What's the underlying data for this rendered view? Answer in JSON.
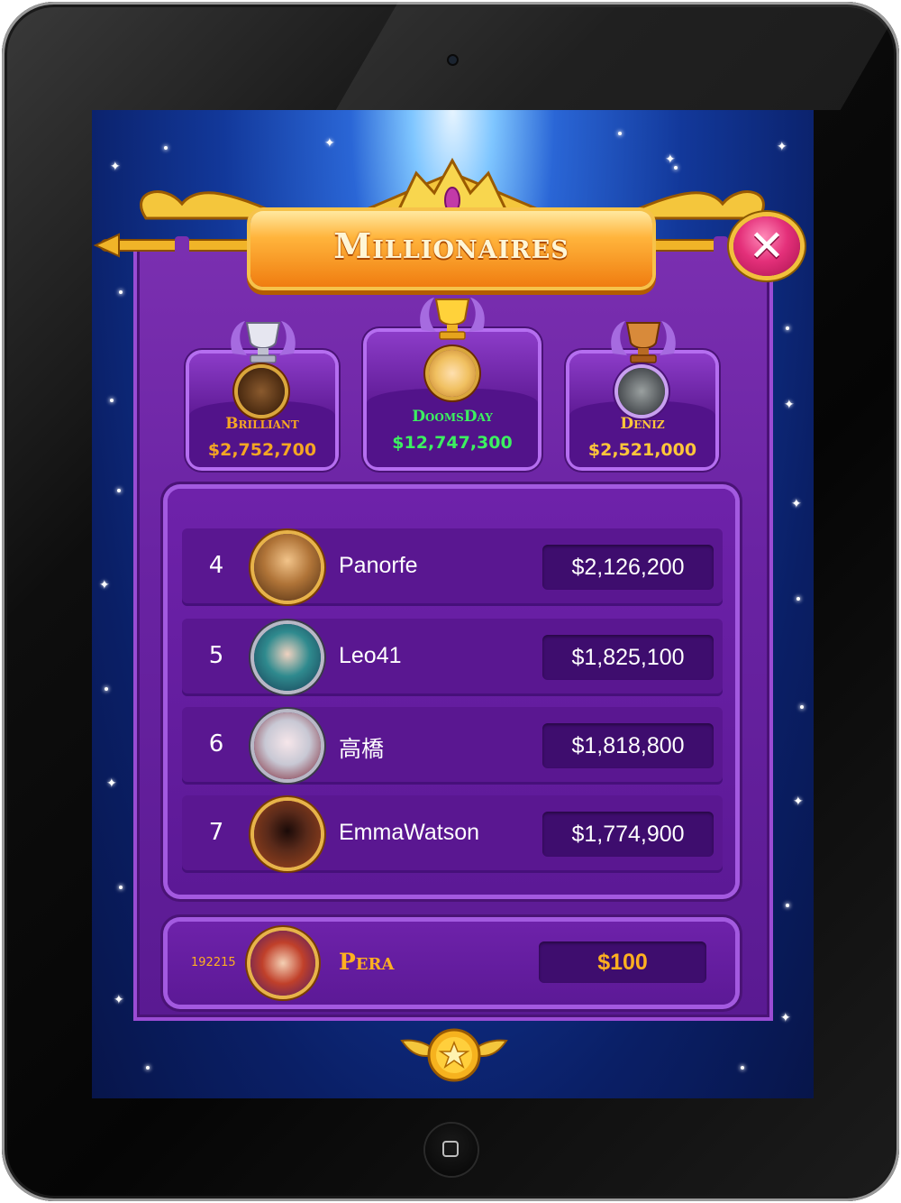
{
  "title": "Millionaires",
  "close_button": {
    "icon": "close-icon"
  },
  "top_three": [
    {
      "place": 2,
      "name": "Brilliant",
      "score": "$2,752,700",
      "trophy": "silver-trophy-icon",
      "name_color": "#f5a623",
      "score_color": "#f5a623"
    },
    {
      "place": 1,
      "name": "DoomsDay",
      "score": "$12,747,300",
      "trophy": "gold-trophy-icon",
      "name_color": "#3cf060",
      "score_color": "#3cf060"
    },
    {
      "place": 3,
      "name": "Deniz",
      "score": "$2,521,000",
      "trophy": "bronze-trophy-icon",
      "name_color": "#ffc63a",
      "score_color": "#ffc63a"
    }
  ],
  "leaderboard": [
    {
      "rank": "4",
      "name": "Panorfe",
      "score": "$2,126,200"
    },
    {
      "rank": "5",
      "name": "Leo41",
      "score": "$1,825,100"
    },
    {
      "rank": "6",
      "name": "高橋",
      "score": "$1,818,800"
    },
    {
      "rank": "7",
      "name": "EmmaWatson",
      "score": "$1,774,900"
    }
  ],
  "current_player": {
    "rank": "192215",
    "name": "Pera",
    "score": "$100",
    "text_color": "#ffb020"
  },
  "footer_badge": {
    "icon": "star-wings-icon"
  }
}
